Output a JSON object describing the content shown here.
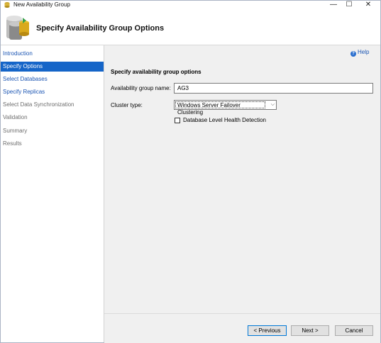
{
  "window": {
    "title": "New Availability Group",
    "controls": {
      "minimize": "—",
      "maximize": "☐",
      "close": "✕"
    }
  },
  "header": {
    "title": "Specify Availability Group Options",
    "icon": "database-wizard-icon"
  },
  "nav": {
    "items": [
      {
        "label": "Introduction",
        "state": "link"
      },
      {
        "label": "Specify Options",
        "state": "active"
      },
      {
        "label": "Select Databases",
        "state": "link"
      },
      {
        "label": "Specify Replicas",
        "state": "link"
      },
      {
        "label": "Select Data Synchronization",
        "state": "disabled"
      },
      {
        "label": "Validation",
        "state": "disabled"
      },
      {
        "label": "Summary",
        "state": "disabled"
      },
      {
        "label": "Results",
        "state": "disabled"
      }
    ]
  },
  "content": {
    "help_label": "Help",
    "help_icon_glyph": "?",
    "section_title": "Specify availability group options",
    "ag_name_label": "Availability group name:",
    "ag_name_value": "AG3",
    "cluster_type_label": "Cluster type:",
    "cluster_type_value": "Windows Server Failover Clustering",
    "cluster_type_arrow": "⌵",
    "health_detection_label": "Database Level Health Detection",
    "health_detection_checked": false
  },
  "footer": {
    "previous_label": "< Previous",
    "next_label": "Next >",
    "cancel_label": "Cancel"
  },
  "colors": {
    "accent": "#1565c8",
    "link": "#1b55b3",
    "disabled": "#6e6e6e"
  }
}
